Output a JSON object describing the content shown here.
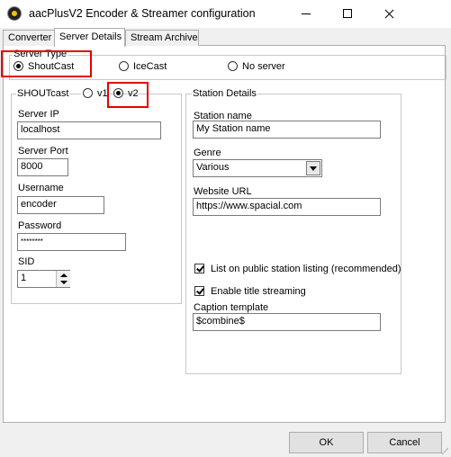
{
  "window": {
    "title": "aacPlusV2 Encoder & Streamer configuration"
  },
  "tabs": [
    {
      "label": "Converter",
      "active": false
    },
    {
      "label": "Server Details",
      "active": true
    },
    {
      "label": "Stream Archive",
      "active": false
    }
  ],
  "server_type": {
    "legend": "Server Type",
    "options": [
      {
        "label": "ShoutCast",
        "selected": true
      },
      {
        "label": "IceCast",
        "selected": false
      },
      {
        "label": "No server",
        "selected": false
      }
    ]
  },
  "shoutcast": {
    "legend": "SHOUTcast",
    "versions": [
      {
        "label": "v1",
        "selected": false
      },
      {
        "label": "v2",
        "selected": true
      }
    ],
    "server_ip_label": "Server IP",
    "server_ip": "localhost",
    "server_port_label": "Server Port",
    "server_port": "8000",
    "username_label": "Username",
    "username": "encoder",
    "password_label": "Password",
    "password_masked": "********",
    "sid_label": "SID",
    "sid": "1"
  },
  "station": {
    "legend": "Station Details",
    "name_label": "Station name",
    "name": "My Station name",
    "genre_label": "Genre",
    "genre": "Various",
    "url_label": "Website URL",
    "url": "https://www.spacial.com",
    "list_public_label": "List on public station listing (recommended)",
    "list_public_checked": true,
    "title_streaming_label": "Enable title streaming",
    "title_streaming_checked": true,
    "caption_label": "Caption template",
    "caption": "$combine$"
  },
  "buttons": {
    "ok": "OK",
    "cancel": "Cancel"
  },
  "colors": {
    "highlight": "#e60000",
    "panel": "#ffffff",
    "chrome": "#f0f0f0"
  }
}
